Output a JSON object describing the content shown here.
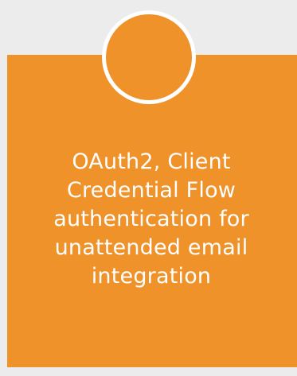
{
  "tile": {
    "caption_lines": [
      "OAuth2, Client",
      "Credential Flow",
      "authentication for",
      "unattended email",
      "integration"
    ]
  },
  "colors": {
    "background": "#ececec",
    "accent": "#f0922a",
    "text": "#ffffff"
  },
  "icons": {
    "badge": "circle-badge-icon"
  }
}
